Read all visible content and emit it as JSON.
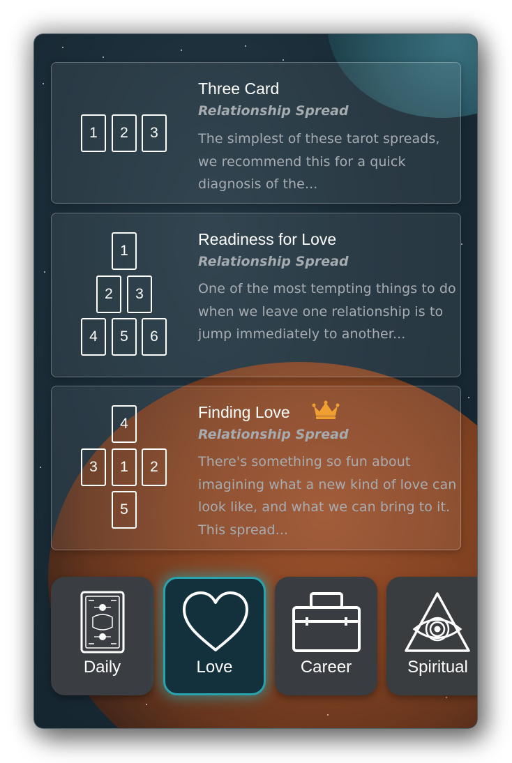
{
  "spreads": [
    {
      "title": "Three Card",
      "subtitle": "Relationship Spread",
      "description": "The simplest of these tarot spreads, we recommend this for a quick diagnosis of the...",
      "slots": [
        "1",
        "2",
        "3"
      ],
      "premium": false
    },
    {
      "title": "Readiness for Love",
      "subtitle": "Relationship Spread",
      "description": "One of the most tempting things to do when we leave one relationship is to jump immediately to another...",
      "slots": [
        "1",
        "2",
        "3",
        "4",
        "5",
        "6"
      ],
      "premium": false
    },
    {
      "title": "Finding Love",
      "subtitle": "Relationship Spread",
      "description": "There's something so fun about imagining what a new kind of love can look like, and what we can bring to it. This spread...",
      "slots": [
        "4",
        "3",
        "1",
        "2",
        "5"
      ],
      "premium": true,
      "badge_icon": "crown-icon"
    }
  ],
  "categories": [
    {
      "label": "Daily",
      "icon": "tarot-card-icon",
      "selected": false
    },
    {
      "label": "Love",
      "icon": "heart-icon",
      "selected": true
    },
    {
      "label": "Career",
      "icon": "briefcase-icon",
      "selected": false
    },
    {
      "label": "Spiritual",
      "icon": "eye-triangle-icon",
      "selected": false
    }
  ],
  "colors": {
    "accent": "#2aa3ac",
    "premium_crown": "#f0a030",
    "subtitle": "#a6abb0",
    "description": "#a7adb2"
  }
}
